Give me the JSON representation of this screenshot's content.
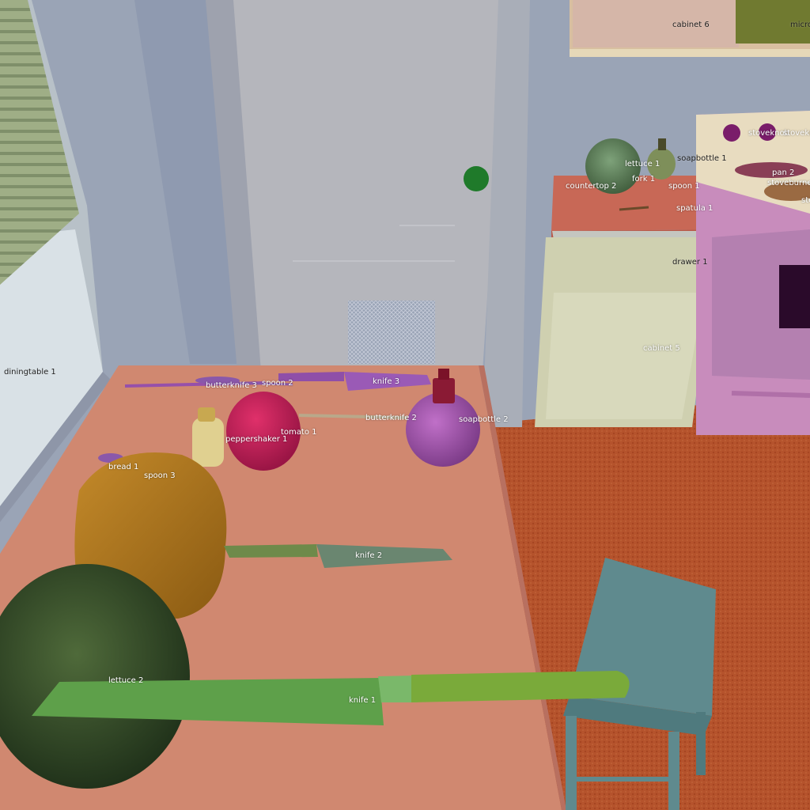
{
  "scene": {
    "colors": {
      "wall": "#9aa4b6",
      "fridge": "#b5b6bc",
      "floor": "#b5532c",
      "table": "#d08870",
      "countertop": "#c86856",
      "cabinet": "#cfd0b0",
      "stove": "#c88cbc"
    }
  },
  "labels": {
    "cabinet6": "cabinet 6",
    "micro": "micro",
    "stoveknob_a": "stoveknob",
    "stoveknob_b": "stovekn",
    "soapbottle1": "soapbottle 1",
    "lettuce1": "lettuce 1",
    "pan2": "pan 2",
    "fork1": "fork 1",
    "countertop2": "countertop 2",
    "spoon1": "spoon 1",
    "stoveburner": "stoveburner",
    "ste": "ste",
    "spatula1": "spatula 1",
    "drawer1": "drawer 1",
    "cabinet5": "cabinet 5",
    "diningtable1": "diningtable 1",
    "butterknife3": "butterknife 3",
    "spoon2": "spoon 2",
    "knife3": "knife 3",
    "butterknife2": "butterknife 2",
    "soapbottle2": "soapbottle 2",
    "tomato1": "tomato 1",
    "peppershaker1": "peppershaker 1",
    "bread1": "bread 1",
    "spoon3": "spoon 3",
    "knife2": "knife 2",
    "lettuce2": "lettuce 2",
    "knife1": "knife 1"
  }
}
